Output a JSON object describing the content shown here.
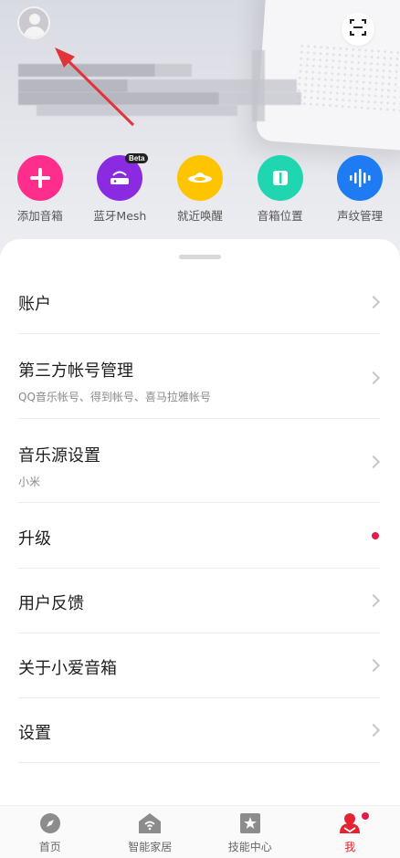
{
  "shortcuts": [
    {
      "label": "添加音箱",
      "icon": "plus-icon",
      "color": "#ff2e8c"
    },
    {
      "label": "蓝牙Mesh",
      "icon": "router-icon",
      "color": "#8a2be2",
      "badge": "Beta"
    },
    {
      "label": "就近唤醒",
      "icon": "wave-disc-icon",
      "color": "#ffc400"
    },
    {
      "label": "音箱位置",
      "icon": "speaker-position-icon",
      "color": "#1fd6b0"
    },
    {
      "label": "声纹管理",
      "icon": "voiceprint-icon",
      "color": "#1e7bf2"
    }
  ],
  "menu": [
    {
      "title": "账户",
      "subtitle": ""
    },
    {
      "title": "第三方帐号管理",
      "subtitle": "QQ音乐帐号、得到帐号、喜马拉雅帐号"
    },
    {
      "title": "音乐源设置",
      "subtitle": "小米"
    },
    {
      "title": "升级",
      "subtitle": ""
    },
    {
      "title": "用户反馈",
      "subtitle": ""
    },
    {
      "title": "关于小爱音箱",
      "subtitle": ""
    },
    {
      "title": "设置",
      "subtitle": ""
    }
  ],
  "tabs": [
    {
      "label": "首页",
      "icon": "compass-icon"
    },
    {
      "label": "智能家居",
      "icon": "smart-home-icon"
    },
    {
      "label": "技能中心",
      "icon": "star-box-icon"
    },
    {
      "label": "我",
      "icon": "me-icon"
    }
  ],
  "colors": {
    "accent": "#e5222f",
    "notification": "#e6194b"
  }
}
